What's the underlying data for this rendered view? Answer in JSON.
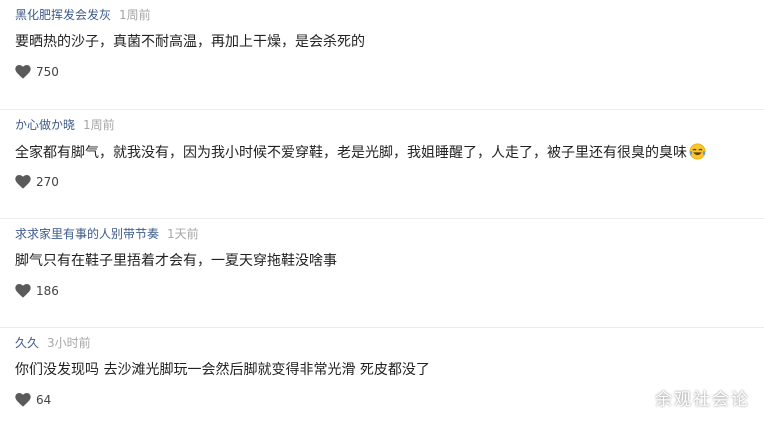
{
  "comments": [
    {
      "author": "黑化肥挥发会发灰",
      "time": "1周前",
      "text": "要晒热的沙子，真菌不耐高温，再加上干燥，是会杀死的",
      "likes": "750",
      "emoji": null
    },
    {
      "author": "か心做か晓",
      "time": "1周前",
      "text": "全家都有脚气，就我没有，因为我小时候不爱穿鞋，老是光脚，我姐睡醒了，人走了，被子里还有很臭的臭味",
      "likes": "270",
      "emoji": "laughing-crying-emoji"
    },
    {
      "author": "求求家里有事的人别带节奏",
      "time": "1天前",
      "text": "脚气只有在鞋子里捂着才会有，一夏天穿拖鞋没啥事",
      "likes": "186",
      "emoji": null
    },
    {
      "author": "久久",
      "time": "3小时前",
      "text": "你们没发现吗 去沙滩光脚玩一会然后脚就变得非常光滑 死皮都没了",
      "likes": "64",
      "emoji": null
    }
  ],
  "watermark": "余观社会论",
  "colors": {
    "author": "#3d5a8a",
    "time": "#a6a6a6",
    "text": "#222222",
    "heart": "#5a5a5a",
    "divider": "#ececec"
  },
  "icons": {
    "like": "heart-icon"
  }
}
